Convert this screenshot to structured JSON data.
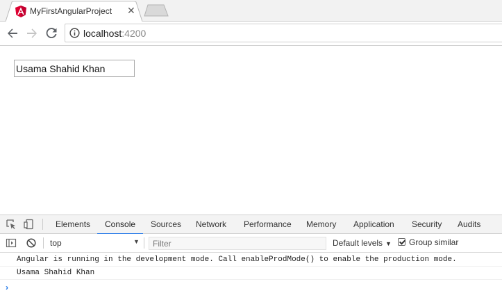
{
  "browser": {
    "tab": {
      "title": "MyFirstAngularProject",
      "close": "✕"
    },
    "omnibox": {
      "host": "localhost",
      "port": ":4200"
    }
  },
  "page": {
    "name_input_value": "Usama Shahid Khan"
  },
  "devtools": {
    "tabs": [
      {
        "label": "Elements"
      },
      {
        "label": "Console"
      },
      {
        "label": "Sources"
      },
      {
        "label": "Network"
      },
      {
        "label": "Performance"
      },
      {
        "label": "Memory"
      },
      {
        "label": "Application"
      },
      {
        "label": "Security"
      },
      {
        "label": "Audits"
      }
    ],
    "active_tab": "Console",
    "console": {
      "context": "top",
      "filter_placeholder": "Filter",
      "levels": "Default levels",
      "group_similar": "Group similar",
      "messages": [
        "Angular is running in the development mode. Call enableProdMode() to enable the production mode.",
        "Usama Shahid Khan"
      ],
      "prompt": "›"
    }
  },
  "colors": {
    "angular_red": "#dd0031",
    "devtools_accent": "#1a73e8"
  }
}
